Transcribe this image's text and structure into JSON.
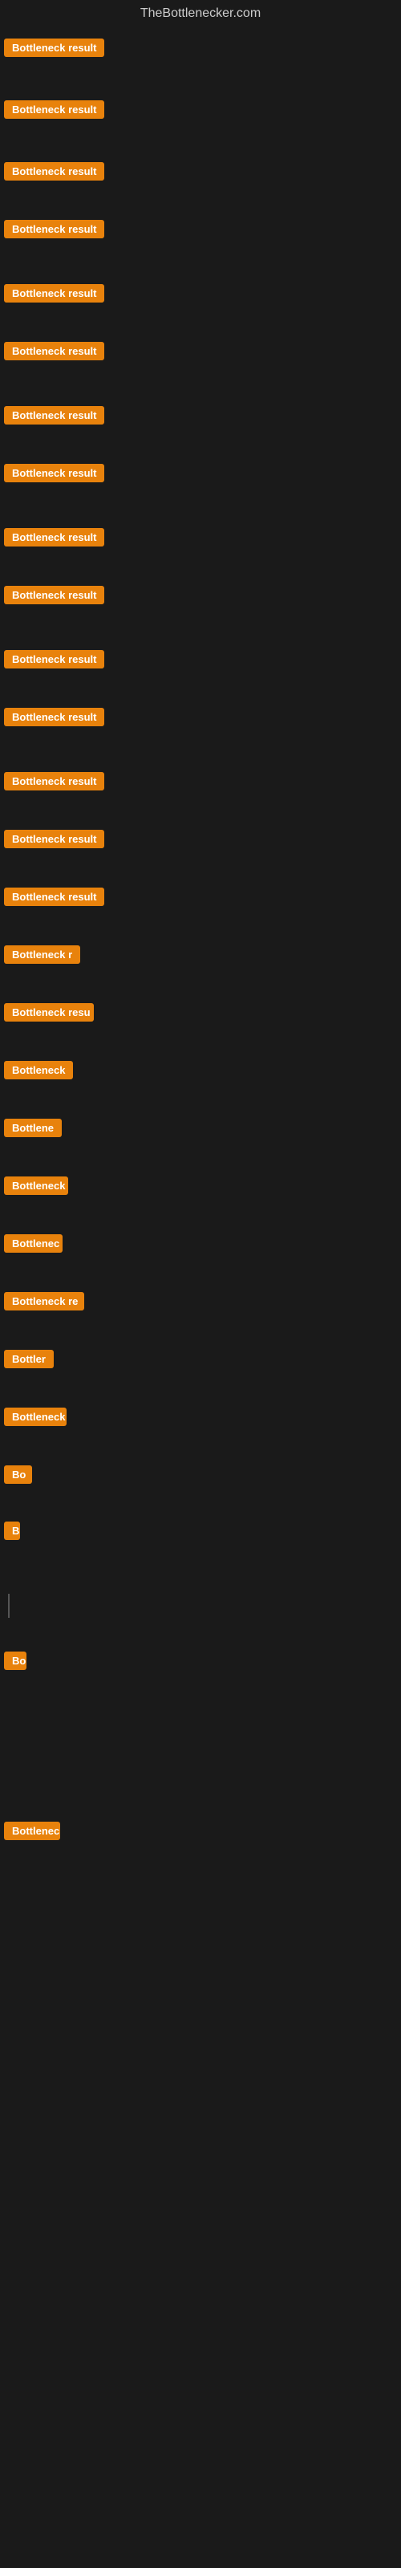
{
  "site": {
    "title": "TheBottlenecker.com"
  },
  "badge_label": "Bottleneck result",
  "items": [
    {
      "id": 1,
      "width_class": "badge-full",
      "label": "Bottleneck result"
    },
    {
      "id": 2,
      "width_class": "badge-full",
      "label": "Bottleneck result"
    },
    {
      "id": 3,
      "width_class": "badge-full",
      "label": "Bottleneck result"
    },
    {
      "id": 4,
      "width_class": "badge-full",
      "label": "Bottleneck result"
    },
    {
      "id": 5,
      "width_class": "badge-full",
      "label": "Bottleneck result"
    },
    {
      "id": 6,
      "width_class": "badge-full",
      "label": "Bottleneck result"
    },
    {
      "id": 7,
      "width_class": "badge-full",
      "label": "Bottleneck result"
    },
    {
      "id": 8,
      "width_class": "badge-full",
      "label": "Bottleneck result"
    },
    {
      "id": 9,
      "width_class": "badge-full",
      "label": "Bottleneck result"
    },
    {
      "id": 10,
      "width_class": "badge-full",
      "label": "Bottleneck result"
    },
    {
      "id": 11,
      "width_class": "badge-full",
      "label": "Bottleneck result"
    },
    {
      "id": 12,
      "width_class": "badge-full",
      "label": "Bottleneck result"
    },
    {
      "id": 13,
      "width_class": "badge-full",
      "label": "Bottleneck result"
    },
    {
      "id": 14,
      "width_class": "badge-full",
      "label": "Bottleneck result"
    },
    {
      "id": 15,
      "width_class": "badge-full",
      "label": "Bottleneck result"
    },
    {
      "id": 16,
      "width_class": "badge-w120",
      "label": "Bottleneck r"
    },
    {
      "id": 17,
      "width_class": "badge-w110",
      "label": "Bottleneck resu"
    },
    {
      "id": 18,
      "width_class": "badge-w90",
      "label": "Bottleneck"
    },
    {
      "id": 19,
      "width_class": "badge-w80",
      "label": "Bottlene"
    },
    {
      "id": 20,
      "width_class": "badge-w80",
      "label": "Bottleneck"
    },
    {
      "id": 21,
      "width_class": "badge-w75",
      "label": "Bottlenec"
    },
    {
      "id": 22,
      "width_class": "badge-w110",
      "label": "Bottleneck re"
    },
    {
      "id": 23,
      "width_class": "badge-w70",
      "label": "Bottler"
    },
    {
      "id": 24,
      "width_class": "badge-w80",
      "label": "Bottleneck"
    },
    {
      "id": 25,
      "width_class": "badge-w40",
      "label": "Bo"
    },
    {
      "id": 26,
      "width_class": "badge-w20",
      "label": "B"
    },
    {
      "id": 27,
      "width_class": "badge-w10",
      "label": ""
    },
    {
      "id": 28,
      "width_class": "badge-w15",
      "label": ""
    },
    {
      "id": 29,
      "width_class": "badge-w30",
      "label": "Bo"
    },
    {
      "id": 30,
      "width_class": "badge-w10",
      "label": ""
    },
    {
      "id": 31,
      "width_class": "badge-w10",
      "label": ""
    },
    {
      "id": 32,
      "width_class": "badge-w10",
      "label": ""
    },
    {
      "id": 33,
      "width_class": "badge-w80",
      "label": "Bottleneck re"
    }
  ]
}
